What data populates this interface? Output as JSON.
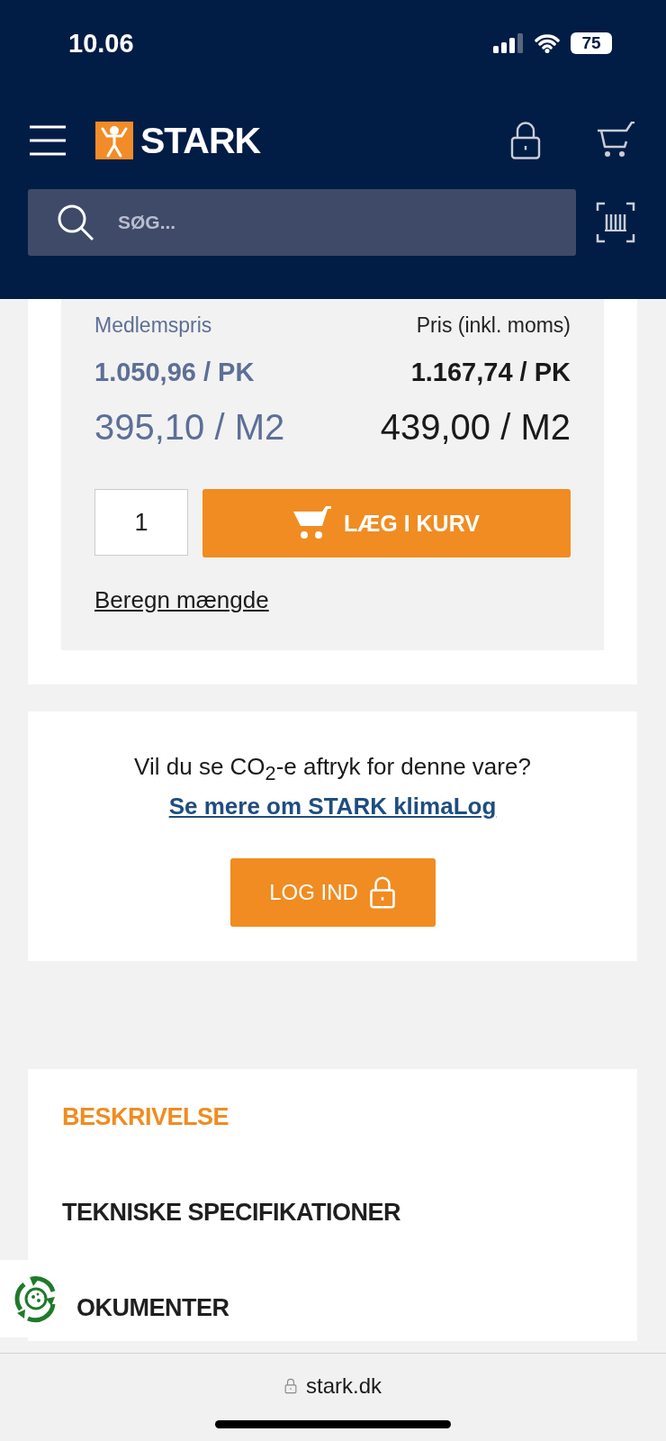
{
  "status_bar": {
    "time": "10.06",
    "battery": "75"
  },
  "header": {
    "logo_text": "STARK",
    "search": {
      "placeholder": "SØG..."
    }
  },
  "price_panel": {
    "member_label": "Medlemspris",
    "price_label": "Pris (inkl. moms)",
    "member_price_unit": "1.050,96 / PK",
    "price_unit": "1.167,74 / PK",
    "member_price_area": "395,10 / M2",
    "price_area": "439,00 / M2",
    "quantity": "1",
    "add_button": "LÆG I KURV",
    "calc_link": "Beregn mængde"
  },
  "climate": {
    "question": "Vil du se CO$_{2}$-e aftryk for denne vare?",
    "link": "Se mere om STARK klimaLog",
    "login_button": "LOG IND"
  },
  "tabs": [
    {
      "label": "BESKRIVELSE",
      "selected": true
    },
    {
      "label": "TEKNISKE SPECIFIKATIONER",
      "selected": false
    },
    {
      "label": "OKUMENTER",
      "selected": false
    }
  ],
  "browser_bar": {
    "url": "stark.dk"
  }
}
